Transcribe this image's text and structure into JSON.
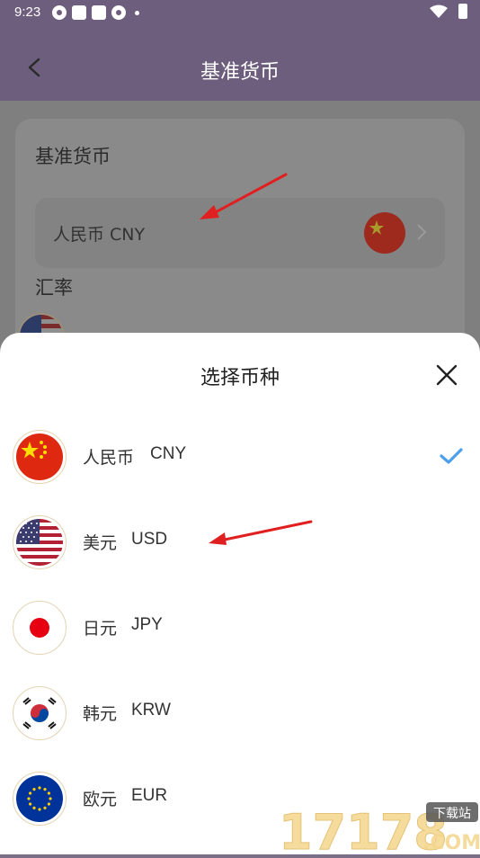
{
  "status_bar": {
    "time": "9:23"
  },
  "header": {
    "title": "基准货币"
  },
  "background": {
    "base_section_title": "基准货币",
    "base_currency_value": "人民币 CNY",
    "rate_section_title": "汇率"
  },
  "sheet": {
    "title": "选择币种",
    "selected_code": "CNY",
    "currencies": [
      {
        "name": "人民币",
        "code": "CNY"
      },
      {
        "name": "美元",
        "code": "USD"
      },
      {
        "name": "日元",
        "code": "JPY"
      },
      {
        "name": "韩元",
        "code": "KRW"
      },
      {
        "name": "欧元",
        "code": "EUR"
      }
    ]
  },
  "watermark": {
    "text": "17178",
    "badge": "下载站",
    "suffix": ".COM"
  },
  "colors": {
    "header_bg": "#6c5e7c",
    "dim_overlay": "#7f7f7f",
    "check": "#4a9eea",
    "arrow": "#e02020",
    "flag_ring": "#e2d4b4"
  }
}
